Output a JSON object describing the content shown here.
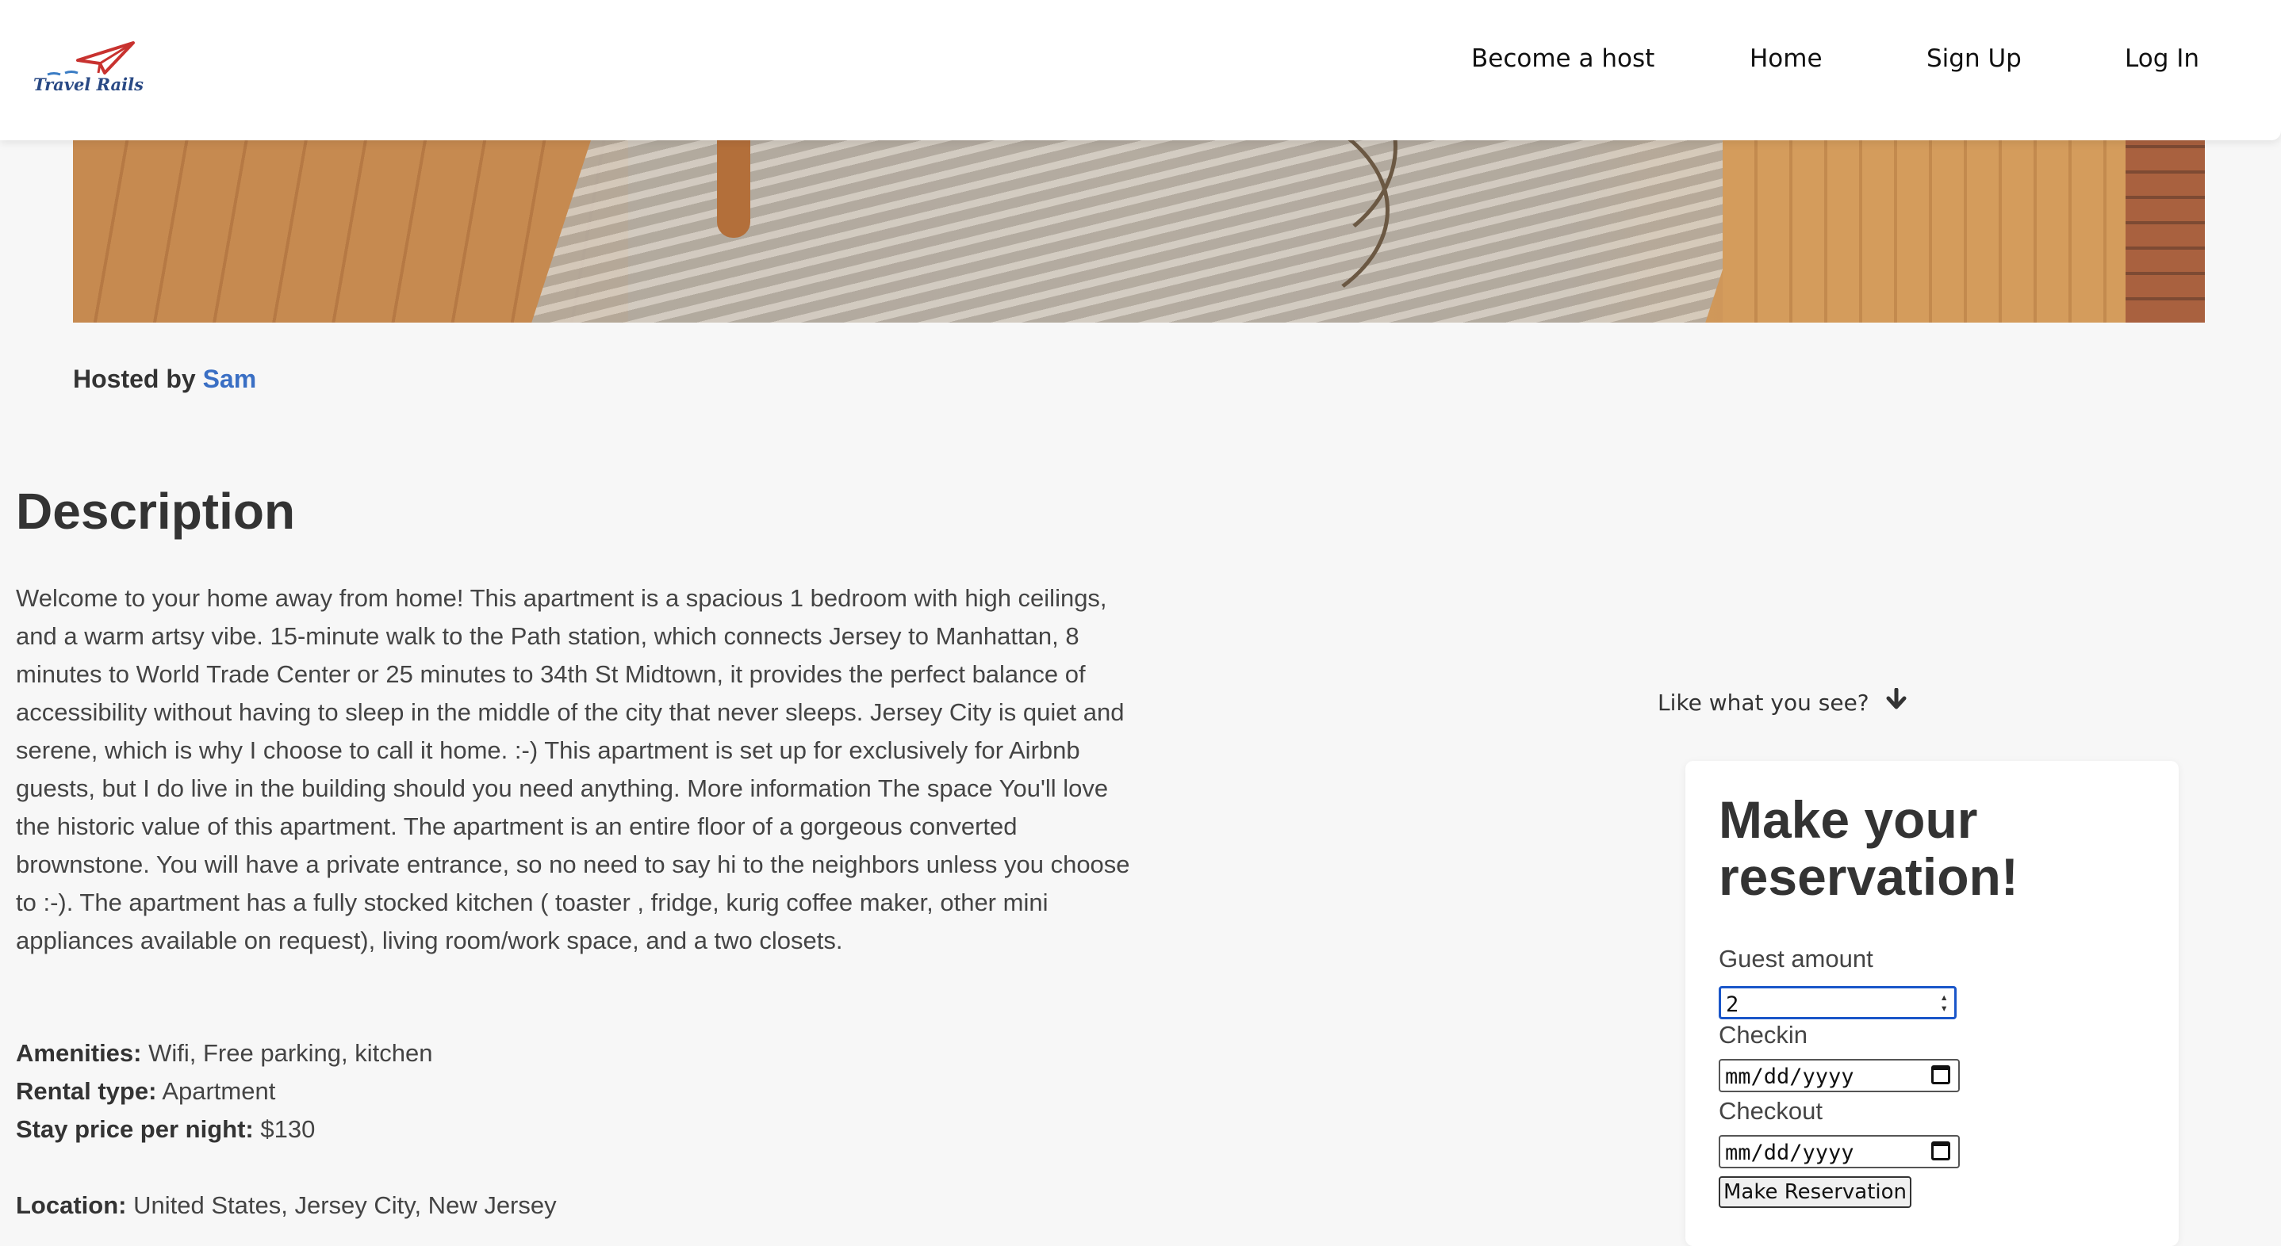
{
  "nav": {
    "logo_text": "Travel Rails",
    "links": [
      "Become a host",
      "Home",
      "Sign Up",
      "Log In"
    ]
  },
  "listing": {
    "hosted_by_label": "Hosted by",
    "host_name": "Sam",
    "description_title": "Description",
    "description": "Welcome to your home away from home! This apartment is a spacious 1 bedroom with high ceilings, and a warm artsy vibe. 15-minute walk to the Path station, which connects Jersey to Manhattan, 8 minutes to World Trade Center or 25 minutes to 34th St Midtown, it provides the perfect balance of accessibility without having to sleep in the middle of the city that never sleeps. Jersey City is quiet and serene, which is why I choose to call it home. :-) This apartment is set up for exclusively for Airbnb guests, but I do live in the building should you need anything. More information The space You'll love the historic value of this apartment. The apartment is an entire floor of a gorgeous converted brownstone. You will have a private entrance, so no need to say hi to the neighbors unless you choose to :-). The apartment has a fully stocked kitchen ( toaster , fridge, kurig coffee maker, other mini appliances available on request), living room/work space, and a two closets.",
    "amenities_label": "Amenities:",
    "amenities": "Wifi, Free parking, kitchen",
    "rental_type_label": "Rental type:",
    "rental_type": "Apartment",
    "price_label": "Stay price per night:",
    "price": "$130",
    "location_label": "Location:",
    "location": "United States, Jersey City, New Jersey"
  },
  "reservation": {
    "teaser": "Like what you see?",
    "title": "Make your reservation!",
    "guest_label": "Guest amount",
    "guest_value": "2",
    "checkin_label": "Checkin",
    "checkin_placeholder": "mm/dd/yyyy",
    "checkout_label": "Checkout",
    "checkout_placeholder": "mm/dd/yyyy",
    "submit_label": "Make Reservation"
  },
  "colors": {
    "link_blue": "#3a6fc4",
    "focus_blue": "#1a56c9",
    "background": "#f7f7f7"
  }
}
